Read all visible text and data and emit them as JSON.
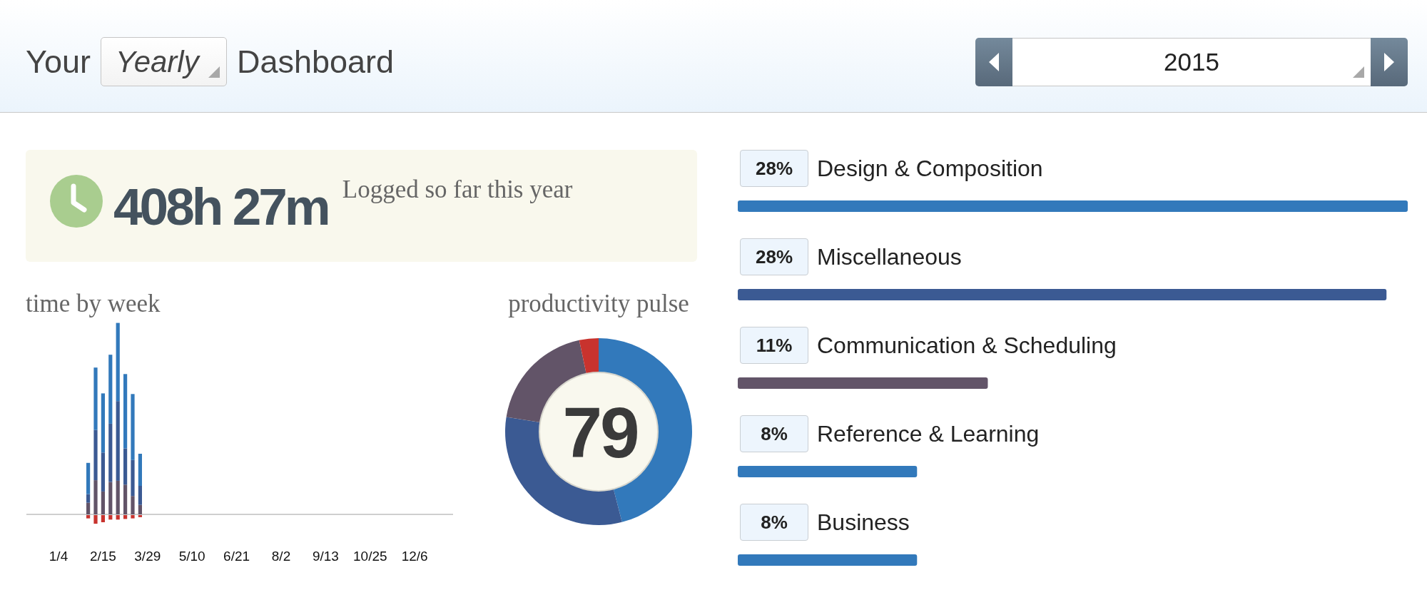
{
  "header": {
    "prefix": "Your",
    "period_select": {
      "value": "Yearly"
    },
    "suffix": "Dashboard",
    "year_picker": {
      "value": "2015"
    }
  },
  "summary": {
    "total": "408h 27m",
    "caption": "Logged so far this year"
  },
  "time_by_week": {
    "title": "time by week",
    "x_labels": [
      "1/4",
      "2/15",
      "3/29",
      "5/10",
      "6/21",
      "8/2",
      "9/13",
      "10/25",
      "12/6"
    ]
  },
  "productivity_pulse": {
    "title": "productivity pulse",
    "score": "79"
  },
  "category_breakdown": {
    "chart_data": {
      "type": "bar",
      "orientation": "horizontal",
      "categories": [
        "Design & Composition",
        "Miscellaneous",
        "Communication & Scheduling",
        "Reference & Learning",
        "Business"
      ],
      "values": [
        28.4,
        27.5,
        10.6,
        7.6,
        7.6
      ],
      "value_labels": [
        "28%",
        "28%",
        "11%",
        "8%",
        "8%"
      ]
    },
    "bars": [
      {
        "color": "#3279bb"
      },
      {
        "color": "#3b5a93"
      },
      {
        "color": "#625468"
      },
      {
        "color": "#3279bb"
      },
      {
        "color": "#3279bb"
      }
    ]
  }
}
